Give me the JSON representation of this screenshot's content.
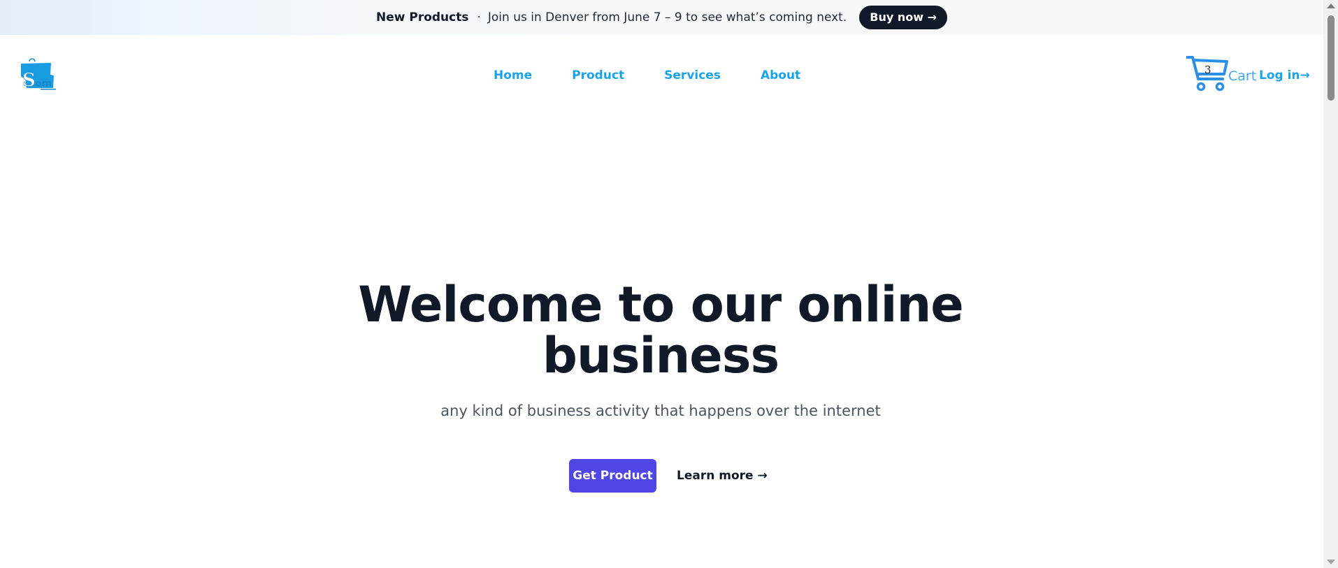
{
  "banner": {
    "label": "New Products",
    "separator": "·",
    "message": "Join us in Denver from June 7 – 9 to see what’s coming next.",
    "button": "Buy now →"
  },
  "header": {
    "logo_text": "Som",
    "nav": [
      "Home",
      "Product",
      "Services",
      "About"
    ],
    "cart_count": "3",
    "cart_label": "Cart",
    "login": "Log in→"
  },
  "hero": {
    "title_line1": "Welcome to our online",
    "title_line2": "business",
    "subtitle": "any kind of business activity that happens over the internet",
    "primary_button": "Get Product",
    "secondary_link": "Learn more →"
  },
  "colors": {
    "nav_link": "#1aa3e8",
    "primary_button": "#4f46e5",
    "banner_button": "#111827",
    "cart_icon": "#2b8fe6"
  },
  "icons": [
    "shopping-bag-logo-icon",
    "cart-icon"
  ]
}
